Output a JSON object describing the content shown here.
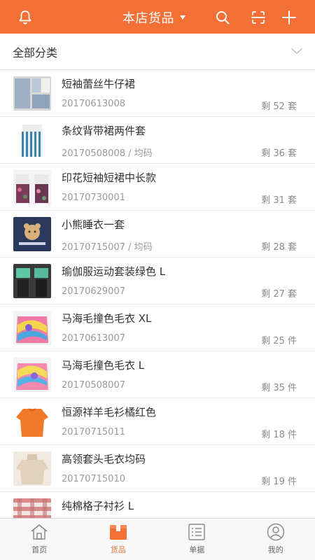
{
  "colors": {
    "accent": "#f26f35",
    "text": "#333333",
    "subtext": "#9a9a9a"
  },
  "header": {
    "title": "本店货品",
    "icons": [
      "bell-icon",
      "caret-down-icon",
      "search-icon",
      "scan-icon",
      "plus-icon"
    ]
  },
  "category": {
    "label": "全部分类",
    "icon": "chevron-down-icon"
  },
  "products": [
    {
      "name": "短袖蕾丝牛仔裙",
      "code": "20170613008",
      "stock": "剩 52 套"
    },
    {
      "name": "条纹背带裙两件套",
      "code": "20170508008 / 均码",
      "stock": "剩 36 套"
    },
    {
      "name": "印花短袖短裙中长款",
      "code": "20170730001",
      "stock": "剩 31 套"
    },
    {
      "name": "小熊睡衣一套",
      "code": "20170715007 / 均码",
      "stock": "剩 28 套"
    },
    {
      "name": "瑜伽服运动套装绿色 L",
      "code": "20170629007",
      "stock": "剩 27 套"
    },
    {
      "name": "马海毛撞色毛衣 XL",
      "code": "20170613007",
      "stock": "剩 25 件"
    },
    {
      "name": "马海毛撞色毛衣 L",
      "code": "20170508007",
      "stock": "剩 35 件"
    },
    {
      "name": "恒源祥羊毛衫橘红色",
      "code": "20170715011",
      "stock": "剩 18 件"
    },
    {
      "name": "高领套头毛衣均码",
      "code": "20170715010",
      "stock": "剩 19 件"
    },
    {
      "name": "纯棉格子衬衫 L",
      "code": "",
      "stock": ""
    }
  ],
  "tabs": [
    {
      "label": "首页",
      "icon": "home-icon",
      "active": false
    },
    {
      "label": "货品",
      "icon": "box-icon",
      "active": true
    },
    {
      "label": "单据",
      "icon": "document-list-icon",
      "active": false
    },
    {
      "label": "我的",
      "icon": "user-icon",
      "active": false
    }
  ]
}
